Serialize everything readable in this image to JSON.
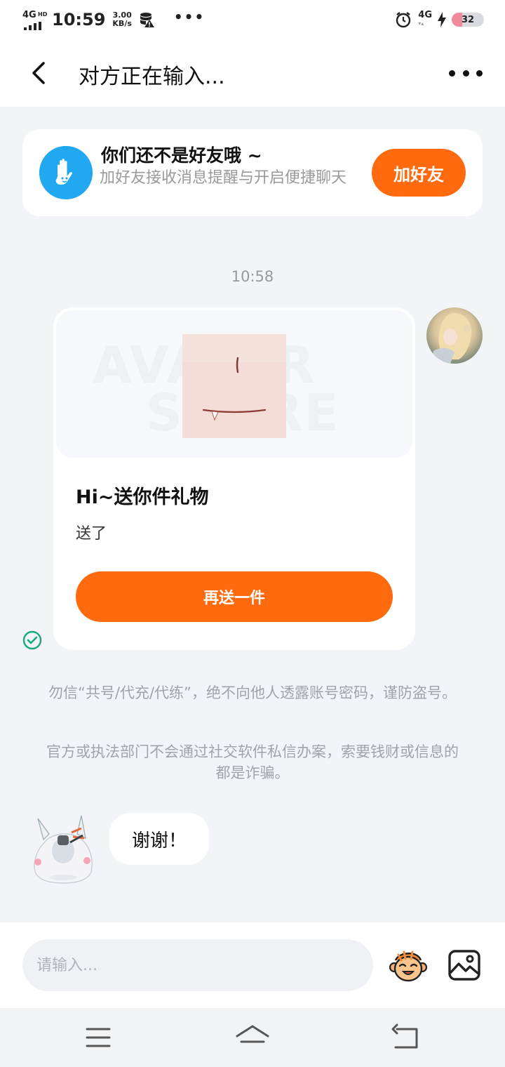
{
  "status_bar": {
    "network_label": "4G",
    "network_hd": "HD",
    "time": "10:59",
    "speed_value": "3.00",
    "speed_unit": "KB/s",
    "overflow": "•••",
    "network_right": "4G",
    "battery": "32",
    "battery_level": 0.32
  },
  "header": {
    "title": "对方正在输入..."
  },
  "friend_banner": {
    "title": "你们还不是好友哦 ~",
    "description": "加好友接收消息提醒与开启便捷聊天",
    "button": "加好友"
  },
  "chat": {
    "timestamp": "10:58",
    "gift_card": {
      "watermark_line1": "AVATAR",
      "watermark_line2": "STORE",
      "title": "Hi~送你件礼物",
      "subtitle": "送了",
      "button": "再送一件"
    },
    "notices": [
      "勿信“共号/代充/代练”，绝不向他人透露账号密码，谨防盗号。",
      "官方或执法部门不会通过社交软件私信办案，索要钱财或信息的都是诈骗。"
    ],
    "reply": "谢谢！"
  },
  "input_bar": {
    "placeholder": "请输入..."
  },
  "colors": {
    "accent": "#ff6a0f",
    "banner_icon": "#22a8f0",
    "sent_check": "#19a97b",
    "background": "#f2f4f7"
  },
  "icons": {
    "back": "chevron-left-icon",
    "more": "more-dots-icon",
    "banner": "hand-icon",
    "sent": "check-circle-icon",
    "emoji": "monkey-emoji-icon",
    "image": "image-icon",
    "nav_menu": "menu-icon",
    "nav_home": "home-icon",
    "nav_back": "back-icon"
  }
}
